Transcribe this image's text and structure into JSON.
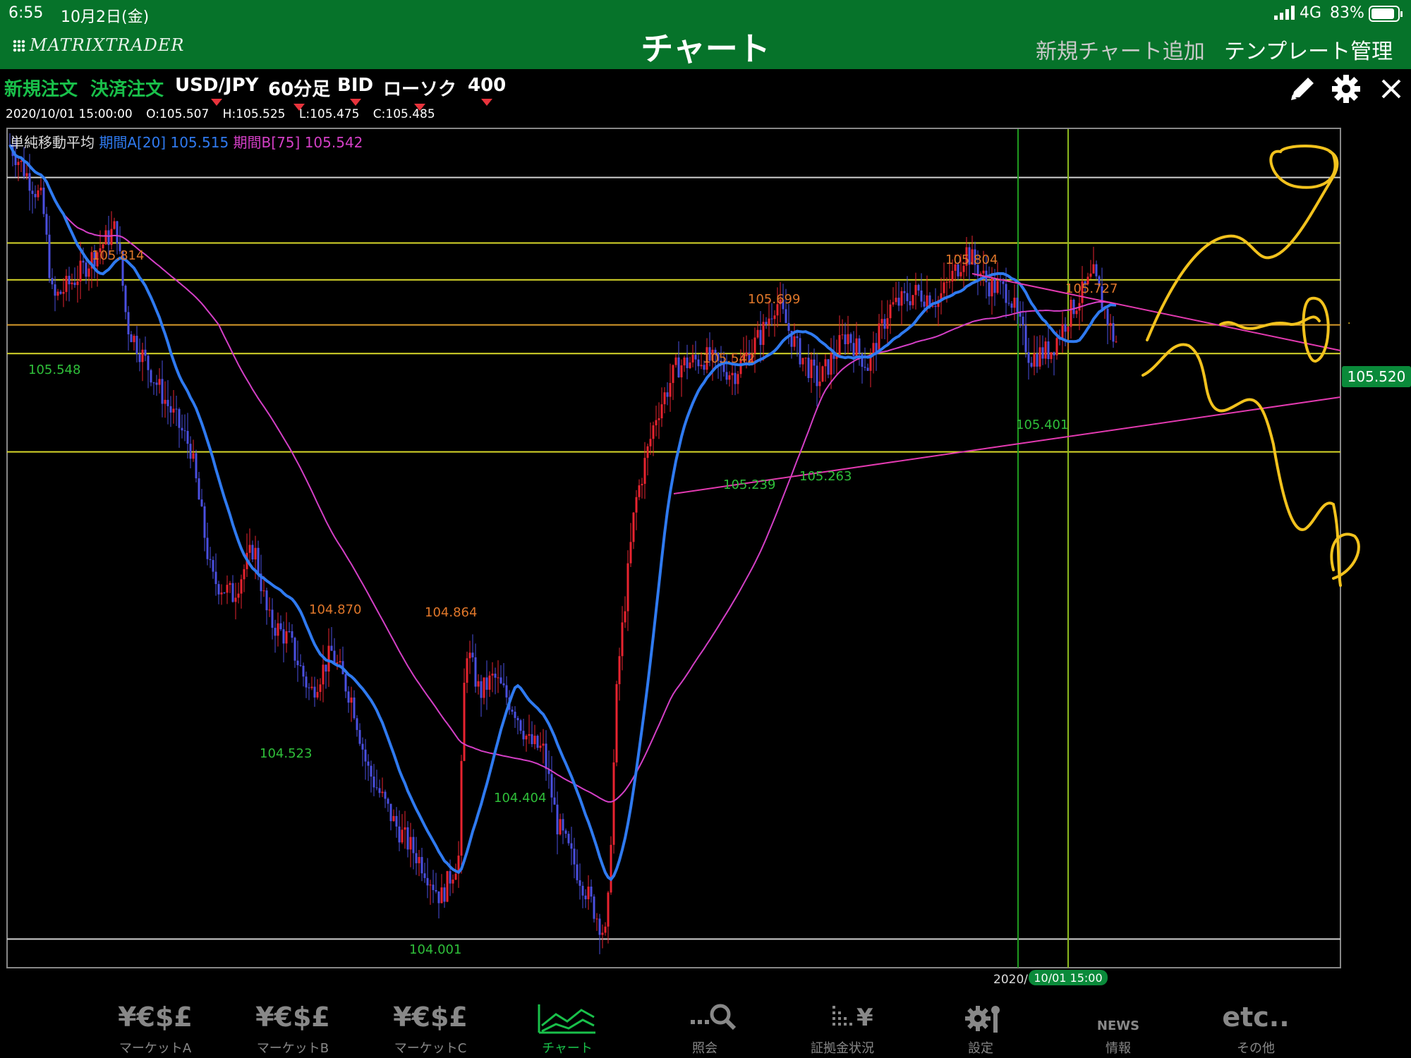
{
  "status": {
    "time": "6:55",
    "date": "10月2日(金)",
    "network": "4G",
    "battery": "83%"
  },
  "nav": {
    "logo": "MATRIXTRADER",
    "title": "チャート",
    "add_chart": "新規チャート追加",
    "template": "テンプレート管理"
  },
  "toolbar": {
    "new_order": "新規注文",
    "close_order": "決済注文",
    "pair": "USD/JPY",
    "timeframe": "60分足",
    "price_type": "BID",
    "chart_type": "ローソク",
    "count": "400"
  },
  "ohlc": {
    "datetime": "2020/10/01 15:00:00",
    "open": "O:105.507",
    "high": "H:105.525",
    "low": "L:105.475",
    "close": "C:105.485"
  },
  "indicator": {
    "name": "単純移動平均",
    "a_label": "期間A[20]",
    "a_value": "105.515",
    "b_label": "期間B[75]",
    "b_value": "105.542"
  },
  "chart_data": {
    "type": "candlestick",
    "instrument": "USD/JPY",
    "ylim": [
      103.95,
      106.0
    ],
    "current_price": "105.520",
    "cursor_label_year": "2020/",
    "cursor_label": "10/01 15:00",
    "annotations_high": [
      "105.814",
      "104.870",
      "104.864",
      "105.542",
      "105.699",
      "105.804",
      "105.727"
    ],
    "annotations_low": [
      "105.548",
      "104.523",
      "104.001",
      "104.404",
      "105.239",
      "105.263",
      "105.401"
    ],
    "horizontal_lines": [
      105.88,
      105.72,
      105.63,
      105.52,
      105.45,
      105.21,
      104.02
    ],
    "colors": {
      "up": "#e8232f",
      "down": "#4a4fe0",
      "ma_a": "#2f7af0",
      "ma_b": "#d43fc6",
      "hline_yellow": "#d8d82a",
      "hline_white": "#d0d0d0",
      "price_tag": "#0a8a3a"
    }
  },
  "tabs": [
    {
      "icon": "¥€$£",
      "label": "マーケットA"
    },
    {
      "icon": "¥€$£",
      "label": "マーケットB"
    },
    {
      "icon": "¥€$£",
      "label": "マーケットC"
    },
    {
      "icon": "",
      "label": "チャート"
    },
    {
      "icon": "",
      "label": "照会"
    },
    {
      "icon": "",
      "label": "証拠金状況"
    },
    {
      "icon": "",
      "label": "設定"
    },
    {
      "icon": "NEWS",
      "label": "情報"
    },
    {
      "icon": "etc..",
      "label": "その他"
    }
  ]
}
